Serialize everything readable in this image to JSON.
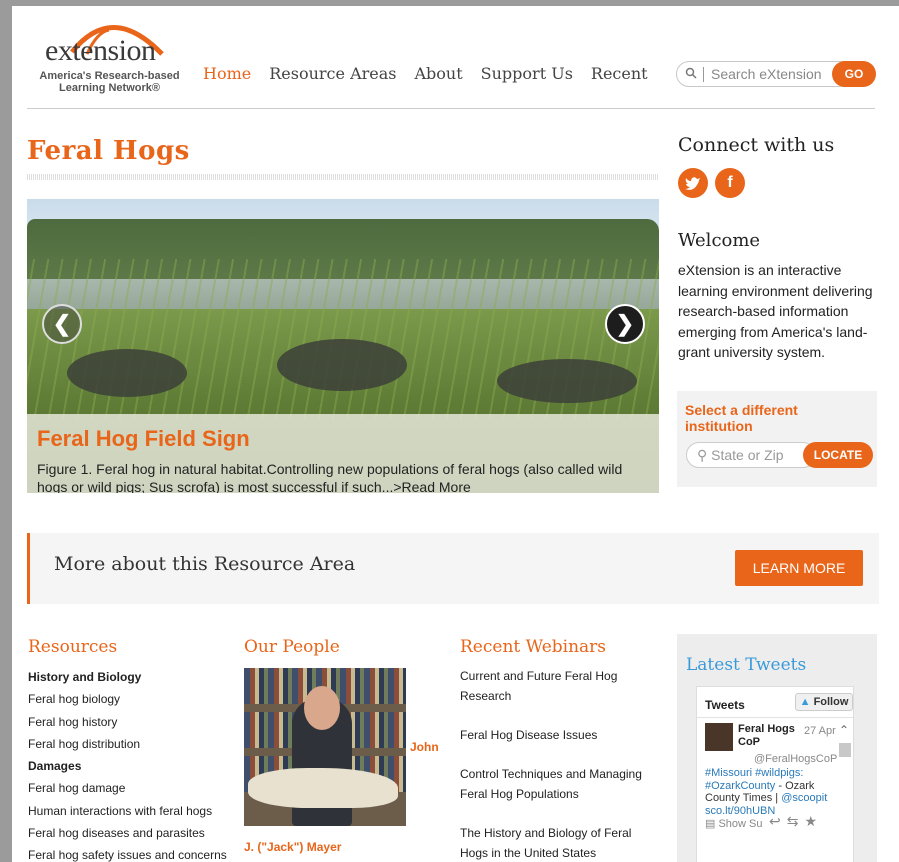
{
  "logo": {
    "wordmark": "extension",
    "tagline": "America's Research-based Learning Network®"
  },
  "nav": {
    "home": "Home",
    "resource_areas": "Resource Areas",
    "about": "About",
    "support_us": "Support Us",
    "recent": "Recent"
  },
  "search": {
    "placeholder": "Search eXtension",
    "go_label": "GO"
  },
  "page_title": "Feral Hogs",
  "slider": {
    "caption_title": "Feral Hog Field Sign",
    "caption_text": "Figure 1. Feral hog in natural habitat.Controlling new populations of feral hogs (also called wild hogs or wild pigs; Sus scrofa) is most successful if such...>Read More"
  },
  "sidebar": {
    "connect_title": "Connect with us",
    "welcome_title": "Welcome",
    "welcome_text": "eXtension is an interactive learning environment delivering research-based information emerging from America's land-grant university system.",
    "institution_label": "Select a different institution",
    "zip_placeholder": "State or Zip",
    "locate_label": "LOCATE"
  },
  "band": {
    "text": "More about this Resource Area",
    "button": "LEARN MORE"
  },
  "resources": {
    "heading": "Resources",
    "items": [
      {
        "label": "History and Biology",
        "kind": "sub"
      },
      {
        "label": "Feral hog biology",
        "kind": "link"
      },
      {
        "label": "Feral hog history",
        "kind": "link"
      },
      {
        "label": "Feral hog distribution",
        "kind": "link"
      },
      {
        "label": "Damages",
        "kind": "sub"
      },
      {
        "label": "Feral hog damage",
        "kind": "link"
      },
      {
        "label": "Human interactions with feral hogs",
        "kind": "link"
      },
      {
        "label": "Feral hog diseases and parasites",
        "kind": "link"
      },
      {
        "label": "Feral hog safety issues and concerns",
        "kind": "link"
      }
    ]
  },
  "people": {
    "heading": "Our People",
    "first_name": "John",
    "name": "J. (\"Jack\") Mayer"
  },
  "webinars": {
    "heading": "Recent Webinars",
    "items": [
      "Current and Future Feral Hog Research",
      "Feral Hog Disease Issues",
      "Control Techniques and Managing Feral Hog Populations",
      "The History and Biology of Feral Hogs in the United States"
    ]
  },
  "tweets": {
    "heading": "Latest Tweets",
    "widget_title": "Tweets",
    "follow_label": "Follow",
    "author": "Feral Hogs CoP",
    "date": "27 Apr",
    "handle": "@FeralHogsCoP",
    "body_hashtags": "#Missouri #wildpigs: #OzarkCounty",
    "body_text": "- Ozark County Times |",
    "body_mention": "@scoopit",
    "body_link": "sco.lt/90hUBN",
    "show_summary": "Show Su"
  },
  "colors": {
    "accent": "#e8651a",
    "twitter": "#3a9ad9"
  }
}
